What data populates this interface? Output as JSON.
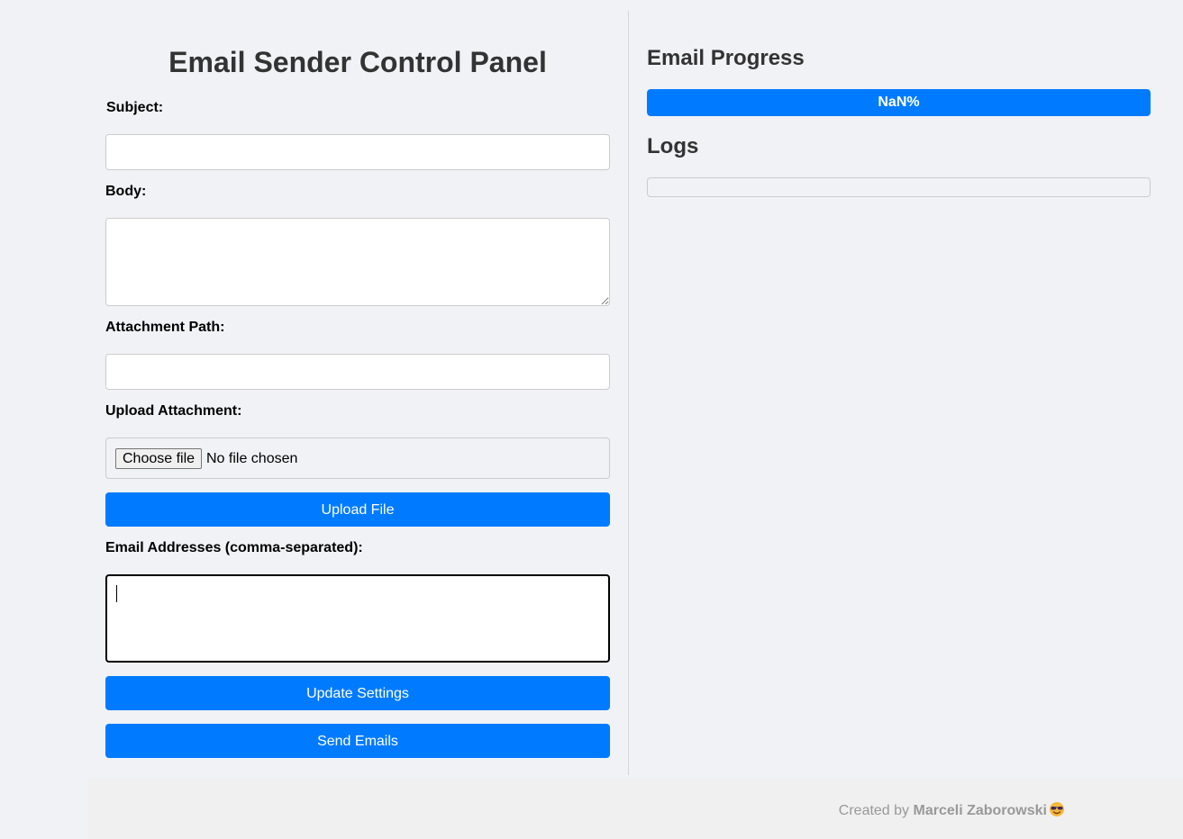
{
  "page": {
    "title": "Email Sender Control Panel"
  },
  "form": {
    "subject_label": "Subject:",
    "subject_value": "",
    "body_label": "Body:",
    "body_value": "",
    "attachment_path_label": "Attachment Path:",
    "attachment_path_value": "",
    "upload_label": "Upload Attachment:",
    "choose_file_label": "Choose file",
    "file_status": "No file chosen",
    "upload_button_label": "Upload File",
    "emails_label": "Email Addresses (comma-separated):",
    "emails_value": "",
    "update_button_label": "Update Settings",
    "send_button_label": "Send Emails"
  },
  "progress": {
    "heading": "Email Progress",
    "text": "NaN%"
  },
  "logs": {
    "heading": "Logs",
    "entries": []
  },
  "footer": {
    "prefix": "Created by",
    "author": "Marceli Zaborowski",
    "icon": "sunglasses-emoji-icon"
  },
  "colors": {
    "accent": "#007bff",
    "background": "#f0f2f5",
    "footer_background": "#f0f0f0"
  }
}
